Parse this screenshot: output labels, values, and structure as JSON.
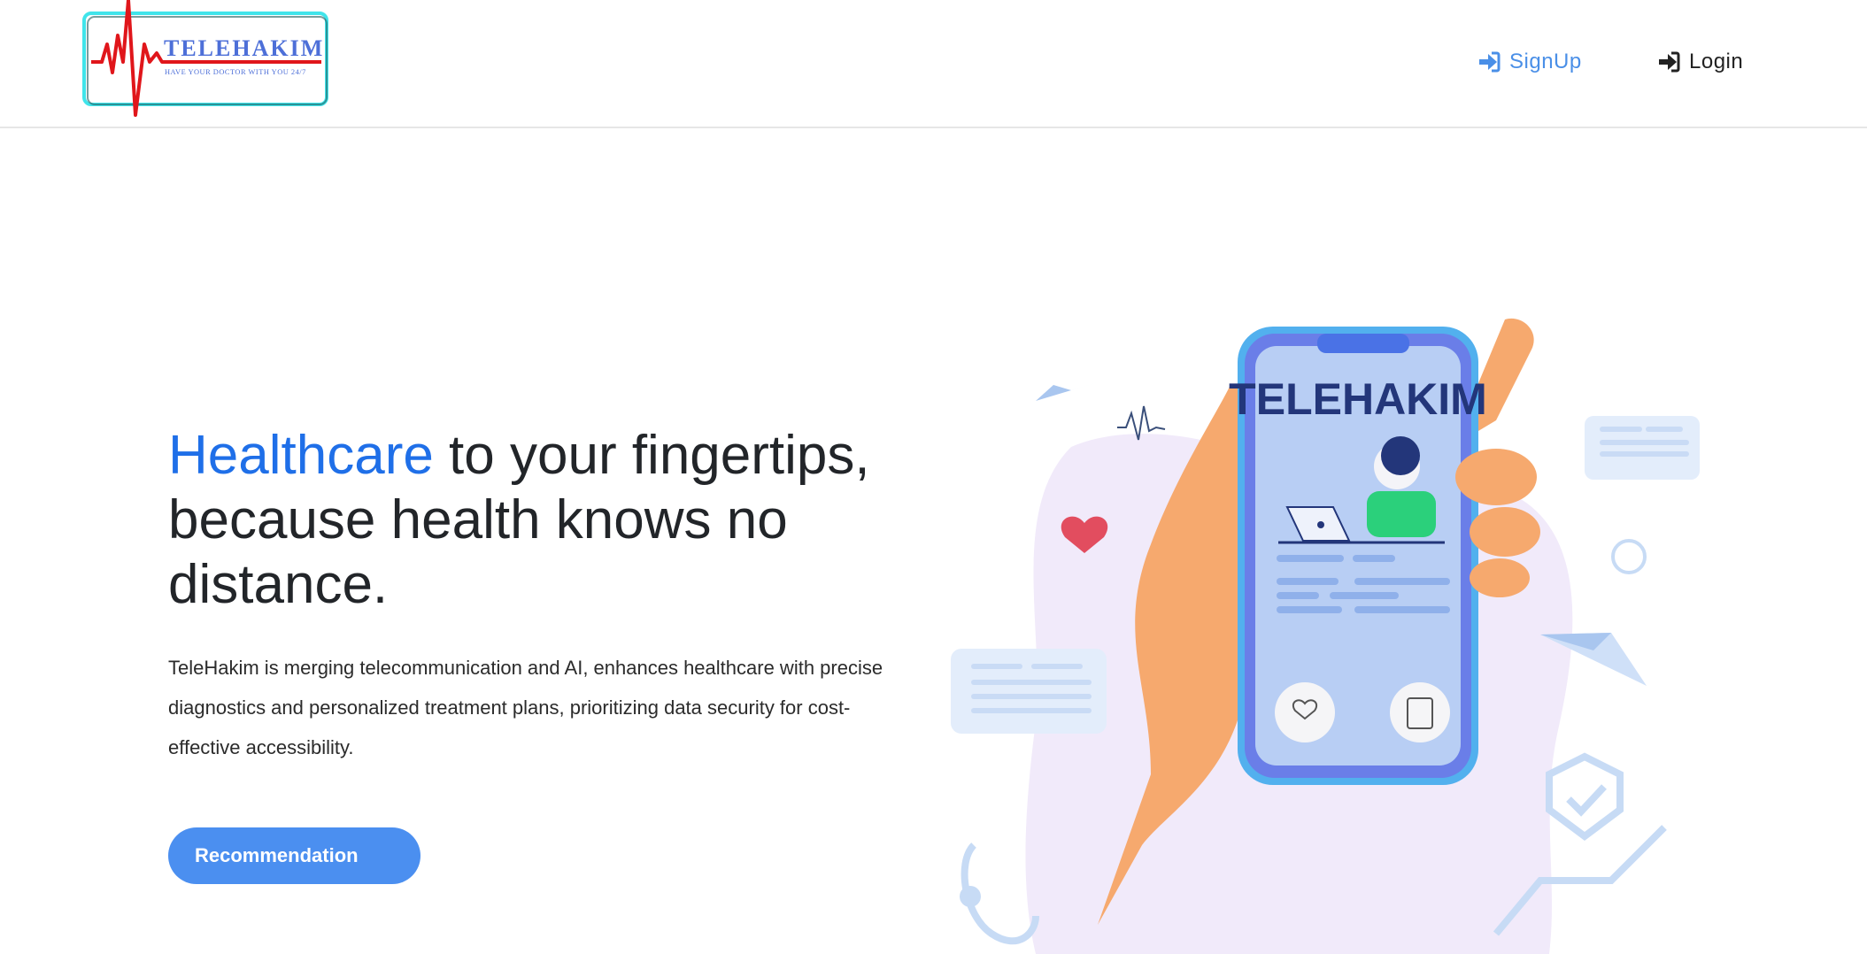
{
  "header": {
    "logo": {
      "name": "TELEHAKIM",
      "tagline": "HAVE YOUR DOCTOR WITH YOU 24/7"
    },
    "nav": {
      "signup_label": "SignUp",
      "login_label": "Login",
      "signup_icon": "sign-in-icon",
      "login_icon": "sign-in-icon"
    }
  },
  "hero": {
    "title_accent": "Healthcare",
    "title_rest": " to your fingertips, because health knows no distance.",
    "description": "TeleHakim is merging telecommunication and AI, enhances healthcare with precise diagnostics and personalized treatment plans, prioritizing data security for cost-effective accessibility.",
    "cta_label": "Recommendation",
    "illustration": {
      "phone_screen_title": "TELEHAKIM"
    }
  },
  "colors": {
    "accent": "#1f6fe8",
    "button": "#4b8ff0",
    "nav_active": "#4a8fe7",
    "logo_pulse": "#e0161b",
    "logo_border": "#3ee6ea"
  }
}
